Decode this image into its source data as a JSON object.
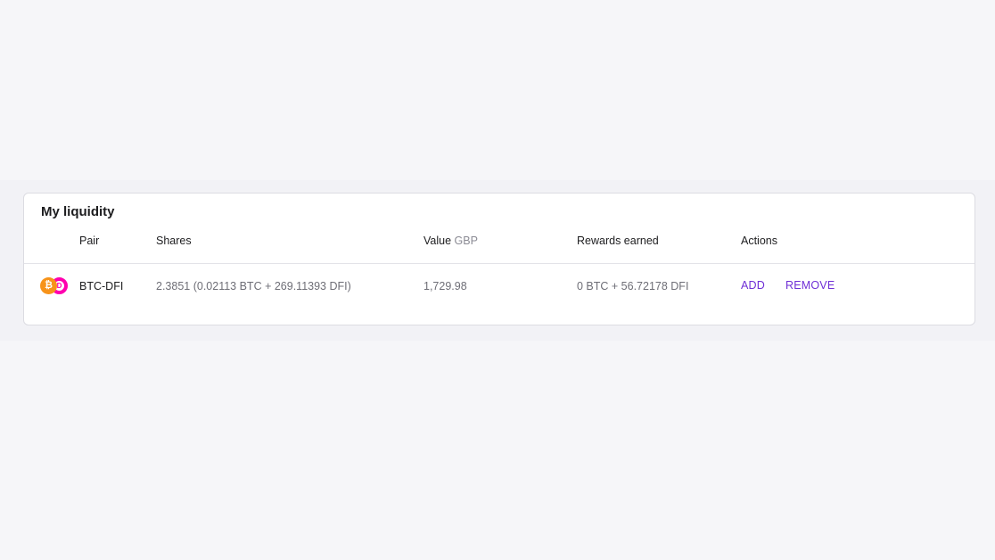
{
  "liquidity": {
    "title": "My liquidity",
    "columns": {
      "pair": "Pair",
      "shares": "Shares",
      "value": "Value",
      "value_currency": "GBP",
      "rewards": "Rewards earned",
      "actions": "Actions"
    },
    "rows": [
      {
        "pair": "BTC-DFI",
        "token_a_icon": "bitcoin-icon",
        "token_b_icon": "defichain-icon",
        "shares": "2.3851 (0.02113 BTC + 269.11393 DFI)",
        "value": "1,729.98",
        "rewards": "0 BTC + 56.72178 DFI",
        "add_label": "ADD",
        "remove_label": "REMOVE"
      }
    ]
  },
  "colors": {
    "accent": "#6f2fd6",
    "btc": "#f7931a",
    "dfi": "#ff00af"
  }
}
